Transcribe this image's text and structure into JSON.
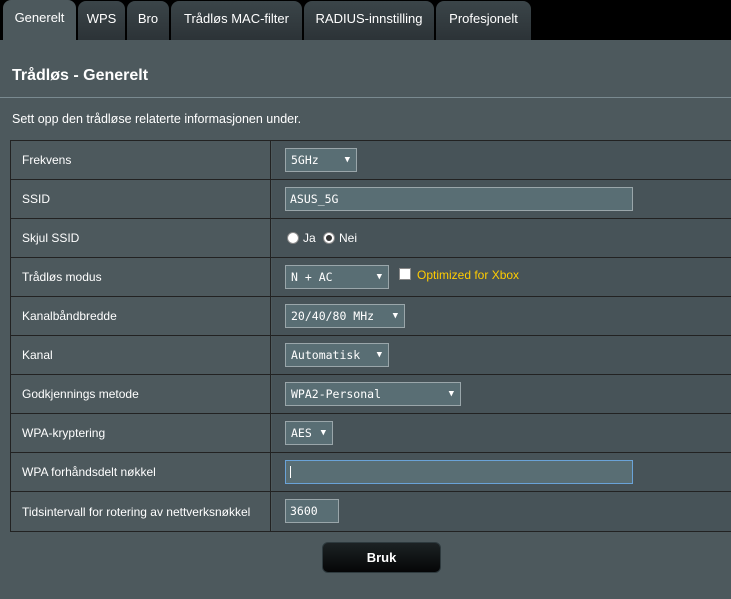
{
  "tabs": [
    "Generelt",
    "WPS",
    "Bro",
    "Trådløs MAC-filter",
    "RADIUS-innstilling",
    "Profesjonelt"
  ],
  "page_title": "Trådløs - Generelt",
  "description": "Sett opp den trådløse relaterte informasjonen under.",
  "fields": {
    "band": {
      "label": "Frekvens",
      "value": "5GHz"
    },
    "ssid": {
      "label": "SSID",
      "value": "ASUS_5G"
    },
    "hide_ssid": {
      "label": "Skjul SSID",
      "option_yes": "Ja",
      "option_no": "Nei",
      "selected": "Nei"
    },
    "mode": {
      "label": "Trådløs modus",
      "value": "N + AC",
      "xbox_label": "Optimized for Xbox",
      "xbox_checked": false
    },
    "bandwidth": {
      "label": "Kanalbåndbredde",
      "value": "20/40/80 MHz"
    },
    "channel": {
      "label": "Kanal",
      "value": "Automatisk"
    },
    "auth": {
      "label": "Godkjennings metode",
      "value": "WPA2-Personal"
    },
    "encryption": {
      "label": "WPA-kryptering",
      "value": "AES"
    },
    "psk": {
      "label": "WPA forhåndsdelt nøkkel",
      "value": ""
    },
    "rekey": {
      "label": "Tidsintervall for rotering av nettverksnøkkel",
      "value": "3600"
    }
  },
  "apply_label": "Bruk",
  "colors": {
    "panel": "#4d595d",
    "accent": "#ffcc00",
    "tab_bg": "#2c3337"
  }
}
